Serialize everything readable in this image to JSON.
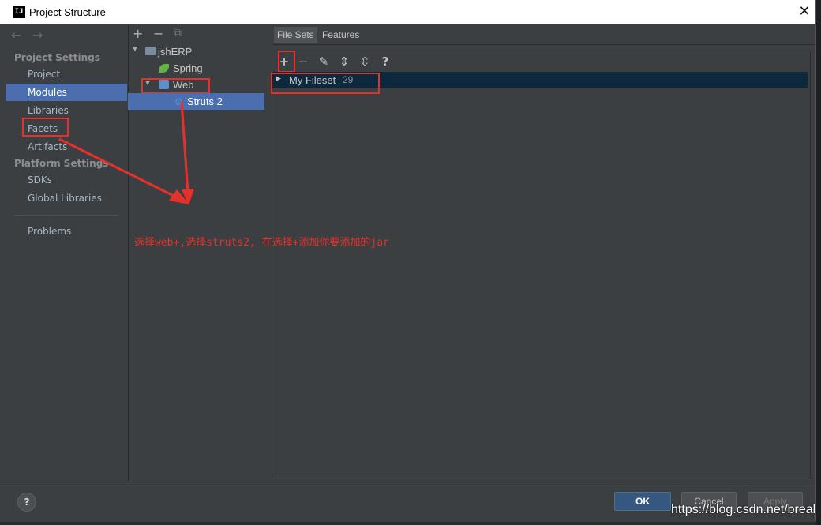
{
  "window": {
    "title": "Project Structure",
    "app_icon_label": "IJ",
    "close_glyph": "✕"
  },
  "nav": {
    "back_glyph": "←",
    "forward_glyph": "→"
  },
  "left": {
    "section_project": "Project Settings",
    "items_project": [
      "Project",
      "Modules",
      "Libraries",
      "Facets",
      "Artifacts"
    ],
    "selected": "Modules",
    "section_platform": "Platform Settings",
    "items_platform": [
      "SDKs",
      "Global Libraries"
    ],
    "problems": "Problems"
  },
  "tree": {
    "toolbar": {
      "add": "+",
      "remove": "−",
      "copy": "⧉"
    },
    "root": "jshERP",
    "spring": "Spring",
    "web": "Web",
    "struts": "Struts 2"
  },
  "tabs": {
    "file_sets": "File Sets",
    "features": "Features"
  },
  "fs_toolbar": {
    "add": "+",
    "remove": "−",
    "edit": "✎",
    "expand": "⇕",
    "collapse": "⇳",
    "help": "?"
  },
  "fileset": {
    "name": "My Fileset",
    "count": "29"
  },
  "annotation": {
    "text": "选择web+,选择struts2, 在选择+添加你要添加的jar"
  },
  "buttons": {
    "ok": "OK",
    "cancel": "Cancel",
    "apply": "Apply",
    "help": "?"
  },
  "watermark": "https://blog.csdn.net/breal",
  "colors": {
    "selection": "#4b6eaf",
    "annotation_red": "#e8302a",
    "panel_bg": "#3c3f41"
  }
}
